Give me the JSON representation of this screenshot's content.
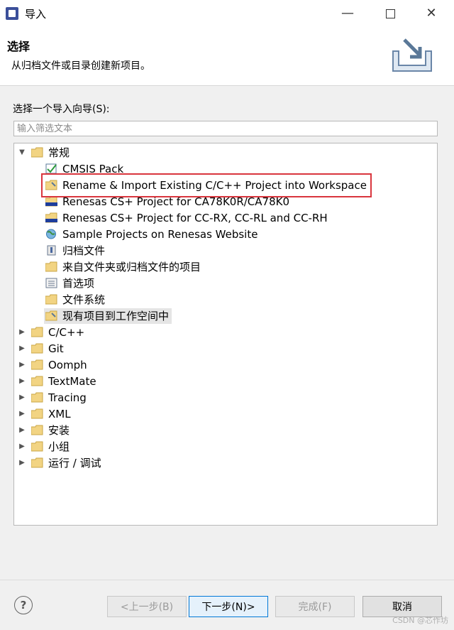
{
  "window": {
    "title": "导入"
  },
  "banner": {
    "title": "选择",
    "description": "从归档文件或目录创建新项目。"
  },
  "filter": {
    "label": "选择一个导入向导(S):",
    "placeholder": "输入筛选文本"
  },
  "tree": {
    "general": {
      "label": "常规",
      "expanded": true,
      "children": [
        {
          "label": "CMSIS Pack",
          "icon": "checkbox-icon"
        },
        {
          "label": "Rename & Import Existing C/C++ Project into Workspace",
          "icon": "import-project-icon"
        },
        {
          "label": "Renesas CS+ Project for CA78K0R/CA78K0",
          "icon": "renesas-folder-icon"
        },
        {
          "label": "Renesas CS+ Project for CC-RX, CC-RL and CC-RH",
          "icon": "renesas-folder-icon"
        },
        {
          "label": "Sample Projects on Renesas Website",
          "icon": "globe-icon"
        },
        {
          "label": "归档文件",
          "icon": "archive-icon"
        },
        {
          "label": "来自文件夹或归档文件的项目",
          "icon": "folder-icon"
        },
        {
          "label": "首选项",
          "icon": "preferences-icon"
        },
        {
          "label": "文件系统",
          "icon": "folder-icon"
        },
        {
          "label": "现有项目到工作空间中",
          "icon": "import-project-icon",
          "selected": true
        }
      ]
    },
    "categories": [
      "C/C++",
      "Git",
      "Oomph",
      "TextMate",
      "Tracing",
      "XML",
      "安装",
      "小组",
      "运行 / 调试"
    ]
  },
  "buttons": {
    "back": "<上一步(B)",
    "next": "下一步(N)>",
    "finish": "完成(F)",
    "cancel": "取消"
  },
  "watermark": "CSDN @芯作坊",
  "colors": {
    "highlight": "#d9363e",
    "accent": "#0078d7"
  }
}
